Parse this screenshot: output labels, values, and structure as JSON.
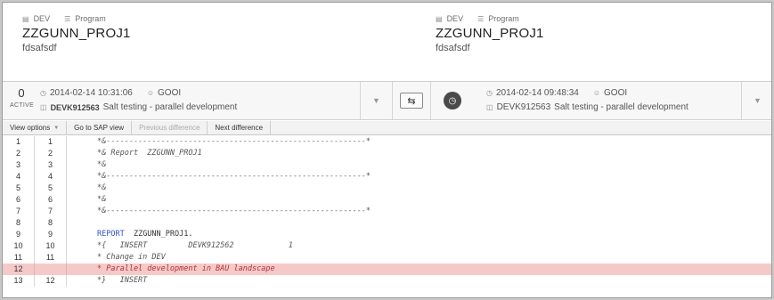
{
  "left_header": {
    "system": "DEV",
    "type": "Program",
    "name": "ZZGUNN_PROJ1",
    "description": "fdsafsdf"
  },
  "right_header": {
    "system": "DEV",
    "type": "Program",
    "name": "ZZGUNN_PROJ1",
    "description": "fdsafsdf"
  },
  "left_version": {
    "number": "0",
    "state": "ACTIVE",
    "timestamp": "2014-02-14 10:31:06",
    "user": "GOOI",
    "request": "DEVK912563",
    "request_text": "Salt testing - parallel development"
  },
  "right_version": {
    "timestamp": "2014-02-14 09:48:34",
    "user": "GOOI",
    "request": "DEVK912563",
    "request_text": "Salt testing - parallel development"
  },
  "toolbar": {
    "view_options": "View options",
    "go_to_sap": "Go to SAP view",
    "previous_difference": "Previous difference",
    "next_difference": "Next difference"
  },
  "icons": {
    "system": "database-icon",
    "type": "program-icon",
    "time": "clock-icon",
    "user": "user-icon",
    "request": "transport-request-icon",
    "swap": "swap-arrows-icon",
    "history": "history-clock-icon",
    "dropdown": "chevron-down-icon"
  },
  "colors": {
    "diff_background": "#f6c9c9",
    "diff_text": "#b03434",
    "keyword": "#2f52c7"
  },
  "code_lines": [
    {
      "left": "1",
      "right": "1",
      "text": "*&---------------------------------------------------------*"
    },
    {
      "left": "2",
      "right": "2",
      "text": "*& Report  ZZGUNN_PROJ1"
    },
    {
      "left": "3",
      "right": "3",
      "text": "*&"
    },
    {
      "left": "4",
      "right": "4",
      "text": "*&---------------------------------------------------------*"
    },
    {
      "left": "5",
      "right": "5",
      "text": "*&"
    },
    {
      "left": "6",
      "right": "6",
      "text": "*&"
    },
    {
      "left": "7",
      "right": "7",
      "text": "*&---------------------------------------------------------*"
    },
    {
      "left": "8",
      "right": "8",
      "text": ""
    },
    {
      "left": "9",
      "right": "9",
      "keyword": "REPORT",
      "text": "  ZZGUNN_PROJ1."
    },
    {
      "left": "10",
      "right": "10",
      "text": "*{   INSERT         DEVK912562            1"
    },
    {
      "left": "11",
      "right": "11",
      "text": "* Change in DEV"
    },
    {
      "left": "12",
      "right": "",
      "text": "* Parallel development in BAU landscape",
      "diff": true
    },
    {
      "left": "13",
      "right": "12",
      "text": "*}   INSERT"
    }
  ]
}
